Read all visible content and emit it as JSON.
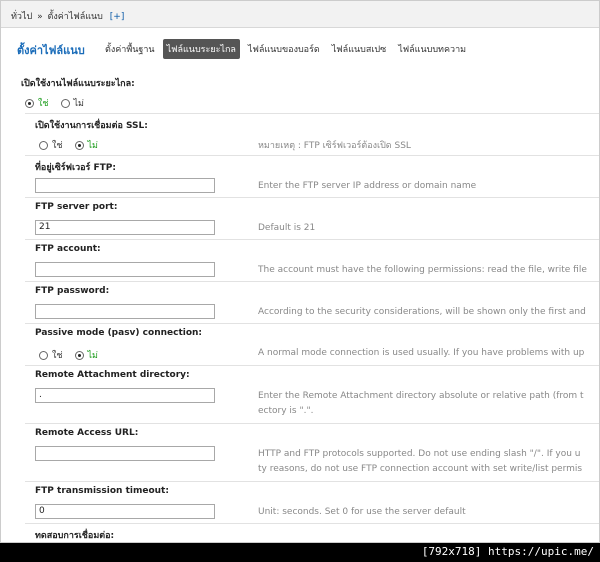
{
  "breadcrumb": {
    "home": "ทั่วไป",
    "separator": "»",
    "current": "ตั้งค่าไฟล์แนบ",
    "add": "[+]"
  },
  "page_title": "ตั้งค่าไฟล์แนบ",
  "tabs": [
    {
      "label": "ตั้งค่าพื้นฐาน",
      "active": false
    },
    {
      "label": "ไฟล์แนบระยะไกล",
      "active": true
    },
    {
      "label": "ไฟล์แนบของบอร์ด",
      "active": false
    },
    {
      "label": "ไฟล์แนบสเปซ",
      "active": false
    },
    {
      "label": "ไฟล์แนบบทความ",
      "active": false
    }
  ],
  "enable_remote": {
    "label": "เปิดใช้งานไฟล์แนบระยะไกล:",
    "yes": "ใช่",
    "no": "ไม่",
    "selected": "yes"
  },
  "ssl": {
    "label": "เปิดใช้งานการเชื่อมต่อ SSL:",
    "yes": "ใช่",
    "no": "ไม่",
    "selected": "no",
    "hint": "หมายเหตุ : FTP เซิร์ฟเวอร์ต้องเปิด SSL"
  },
  "ftp_host": {
    "label": "ที่อยู่เซิร์ฟเวอร์ FTP:",
    "value": "",
    "hint": "Enter the FTP server IP address or domain name"
  },
  "ftp_port": {
    "label": "FTP server port:",
    "value": "21",
    "hint": "Default is 21"
  },
  "ftp_account": {
    "label": "FTP account:",
    "value": "",
    "hint": "The account must have the following permissions: read the file, write file"
  },
  "ftp_password": {
    "label": "FTP password:",
    "value": "",
    "hint": "According to the security considerations, will be shown only the first and"
  },
  "passive": {
    "label": "Passive mode (pasv) connection:",
    "yes": "ใช่",
    "no": "ไม่",
    "selected": "no",
    "hint": "A normal mode connection is used usually. If you have problems with up"
  },
  "remote_dir": {
    "label": "Remote Attachment directory:",
    "value": ".",
    "hint_line1": "Enter the Remote Attachment directory absolute or relative path (from t",
    "hint_line2": "ectory is \".\"."
  },
  "remote_url": {
    "label": "Remote Access URL:",
    "value": "",
    "hint_line1": "HTTP and FTP protocols supported. Do not use ending slash \"/\". If you u",
    "hint_line2": "ty reasons, do not use FTP connection account with set write/list permis"
  },
  "ftp_timeout": {
    "label": "FTP transmission timeout:",
    "value": "0",
    "hint": "Unit: seconds. Set 0 for use the server default"
  },
  "test_connection": {
    "label": "ทดสอบการเชื่อมต่อ:"
  },
  "watermark": "[792x718] https://upic.me/"
}
